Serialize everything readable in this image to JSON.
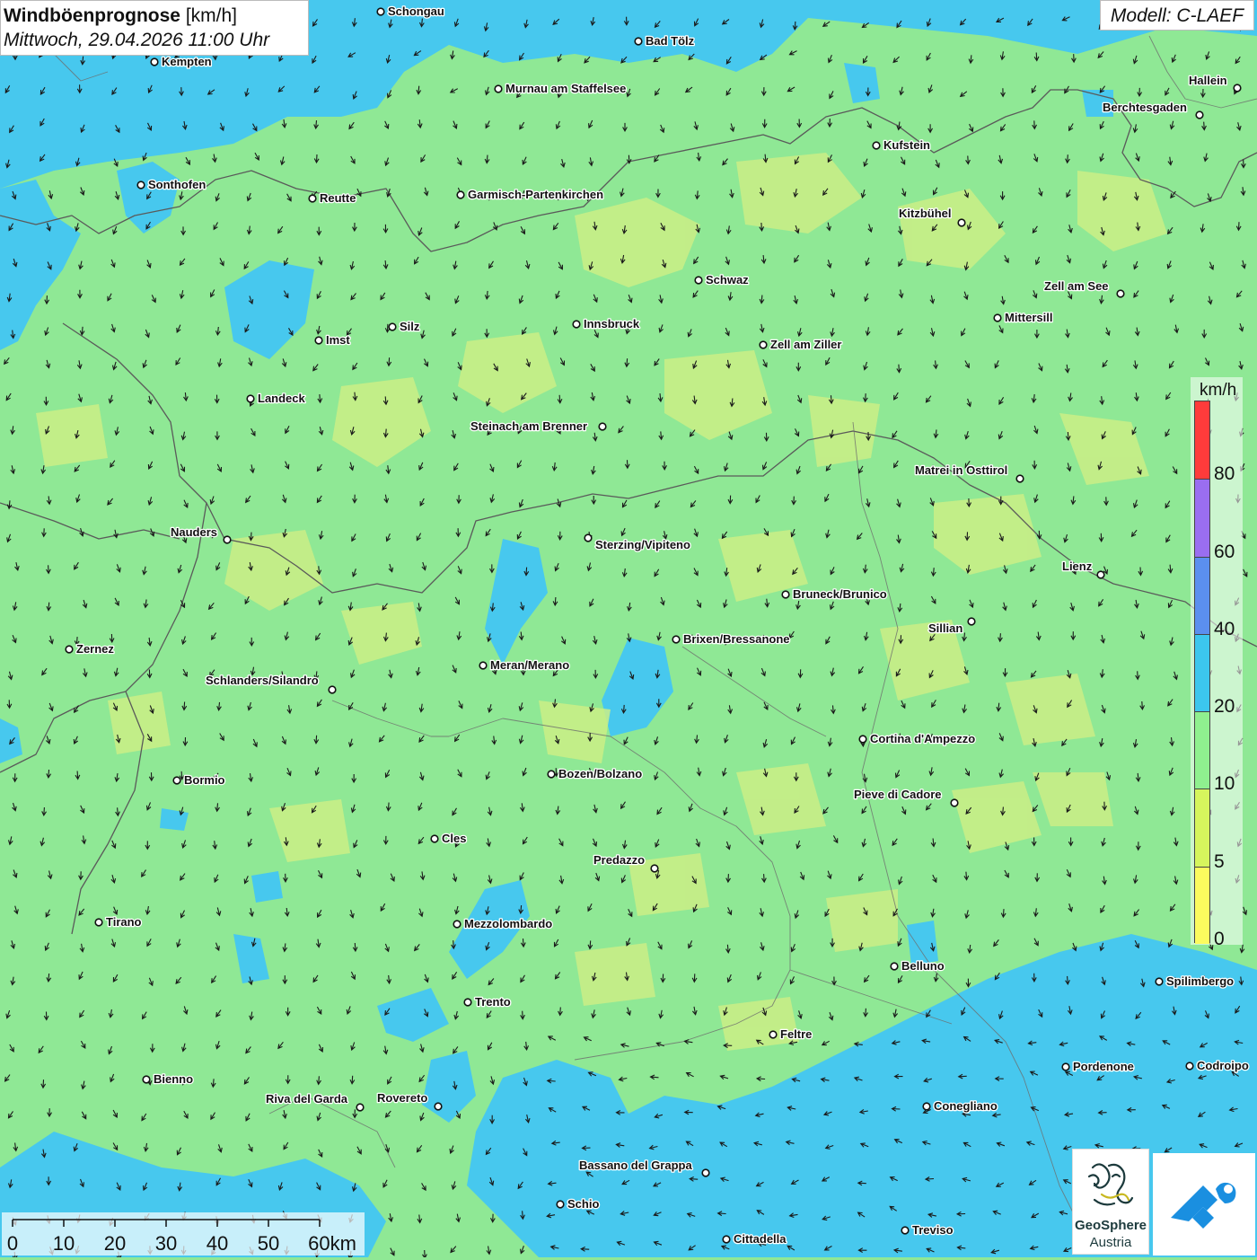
{
  "title": {
    "main": "Windböenprognose",
    "unit": "[km/h]",
    "datetime": "Mittwoch, 29.04.2026 11:00 Uhr"
  },
  "model": "Modell: C-LAEF",
  "legend": {
    "unit": "km/h",
    "ticks": [
      "80",
      "60",
      "40",
      "20",
      "10",
      "5",
      "0"
    ],
    "colors": [
      "#ff3b3b",
      "#9a6ef0",
      "#5b8fef",
      "#3cc6ee",
      "#8ff08f",
      "#d6f55d",
      "#fbfb5e"
    ]
  },
  "scale": {
    "labels": [
      "0",
      "10",
      "20",
      "30",
      "40",
      "50",
      "60km"
    ]
  },
  "colors": {
    "water": "#47c8ee",
    "land": "#8fe895",
    "low_wind": "#cbee86",
    "border": "#5a5a5a"
  },
  "cities": [
    {
      "name": "Schongau"
    },
    {
      "name": "Bad Tölz"
    },
    {
      "name": "Kempten"
    },
    {
      "name": "Hallein"
    },
    {
      "name": "Murnau am Staffelsee"
    },
    {
      "name": "Berchtesgaden"
    },
    {
      "name": "Kufstein"
    },
    {
      "name": "Sonthofen"
    },
    {
      "name": "Reutte"
    },
    {
      "name": "Garmisch-Partenkirchen"
    },
    {
      "name": "Kitzbühel"
    },
    {
      "name": "Schwaz"
    },
    {
      "name": "Zell am See"
    },
    {
      "name": "Mittersill"
    },
    {
      "name": "Silz"
    },
    {
      "name": "Innsbruck"
    },
    {
      "name": "Imst"
    },
    {
      "name": "Zell am Ziller"
    },
    {
      "name": "Landeck"
    },
    {
      "name": "Steinach am Brenner"
    },
    {
      "name": "Matrei in Osttirol"
    },
    {
      "name": "Nauders"
    },
    {
      "name": "Sterzing/Vipiteno"
    },
    {
      "name": "Lienz"
    },
    {
      "name": "Bruneck/Brunico"
    },
    {
      "name": "Sillian"
    },
    {
      "name": "Zernez"
    },
    {
      "name": "Brixen/Bressanone"
    },
    {
      "name": "Meran/Merano"
    },
    {
      "name": "Schlanders/Silandro"
    },
    {
      "name": "Cortina d'Ampezzo"
    },
    {
      "name": "Bozen/Bolzano"
    },
    {
      "name": "Bormio"
    },
    {
      "name": "Pieve di Cadore"
    },
    {
      "name": "Cles"
    },
    {
      "name": "Predazzo"
    },
    {
      "name": "Tirano"
    },
    {
      "name": "Mezzolombardo"
    },
    {
      "name": "Belluno"
    },
    {
      "name": "Spilimbergo"
    },
    {
      "name": "Trento"
    },
    {
      "name": "Feltre"
    },
    {
      "name": "Pordenone"
    },
    {
      "name": "Codroipo"
    },
    {
      "name": "Bienno"
    },
    {
      "name": "Riva del Garda"
    },
    {
      "name": "Rovereto"
    },
    {
      "name": "Conegliano"
    },
    {
      "name": "Bassano del Grappa"
    },
    {
      "name": "Schio"
    },
    {
      "name": "Treviso"
    },
    {
      "name": "Cittadella"
    }
  ],
  "logos": {
    "geosphere_line1": "GeoSphere",
    "geosphere_line2": "Austria"
  }
}
